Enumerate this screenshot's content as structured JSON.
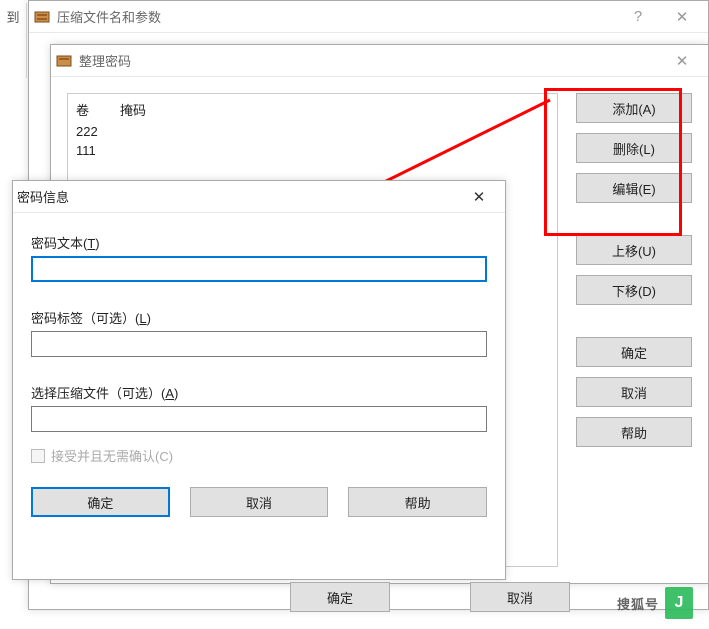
{
  "edge_text": "到",
  "w1": {
    "title": "压缩文件名和参数"
  },
  "w2": {
    "title": "整理密码",
    "header": {
      "col1": "卷",
      "col2": "掩码"
    },
    "rows": [
      "222",
      "111"
    ],
    "buttons": {
      "add": "添加(A)",
      "delete": "删除(L)",
      "edit": "编辑(E)",
      "up": "上移(U)",
      "down": "下移(D)",
      "ok": "确定",
      "cancel": "取消",
      "help": "帮助"
    }
  },
  "w3": {
    "title": "密码信息",
    "labels": {
      "password_prefix": "密码文本(",
      "password_u": "T",
      "password_suffix": ")",
      "label_prefix": "密码标签（可选）(",
      "label_u": "L",
      "label_suffix": ")",
      "archive_prefix": "选择压缩文件（可选）(",
      "archive_u": "A",
      "archive_suffix": ")",
      "accept_prefix": "接受并且无需确认(",
      "accept_u": "C",
      "accept_suffix": ")"
    },
    "buttons": {
      "ok": "确定",
      "cancel": "取消",
      "help": "帮助"
    }
  },
  "bottom": {
    "ok": "确定",
    "cancel": "取消"
  },
  "watermark": "搜狐号"
}
